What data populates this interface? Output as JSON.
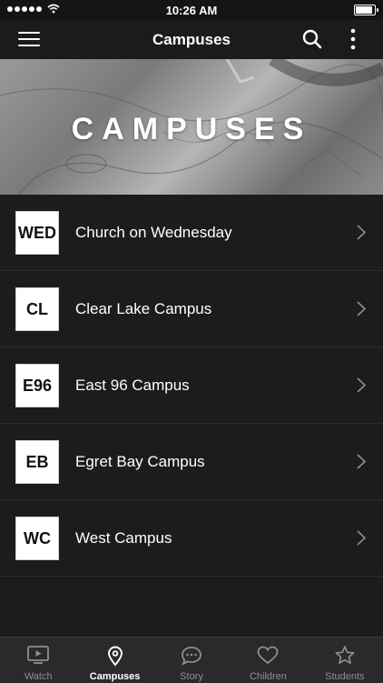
{
  "status": {
    "time": "10:26 AM"
  },
  "nav": {
    "title": "Campuses"
  },
  "hero": {
    "title": "CAMPUSES"
  },
  "campuses": [
    {
      "code": "WED",
      "name": "Church on Wednesday"
    },
    {
      "code": "CL",
      "name": "Clear Lake Campus"
    },
    {
      "code": "E96",
      "name": "East 96 Campus"
    },
    {
      "code": "EB",
      "name": "Egret Bay Campus"
    },
    {
      "code": "WC",
      "name": "West Campus"
    }
  ],
  "tabs": [
    {
      "label": "Watch",
      "icon": "tv-play-icon",
      "active": false
    },
    {
      "label": "Campuses",
      "icon": "map-pin-icon",
      "active": true
    },
    {
      "label": "Story",
      "icon": "chat-bubble-icon",
      "active": false
    },
    {
      "label": "Children",
      "icon": "heart-icon",
      "active": false
    },
    {
      "label": "Students",
      "icon": "star-icon",
      "active": false
    }
  ],
  "colors": {
    "background": "#1c1c1e",
    "tab_inactive": "#8e8e93",
    "tab_active": "#ffffff"
  }
}
